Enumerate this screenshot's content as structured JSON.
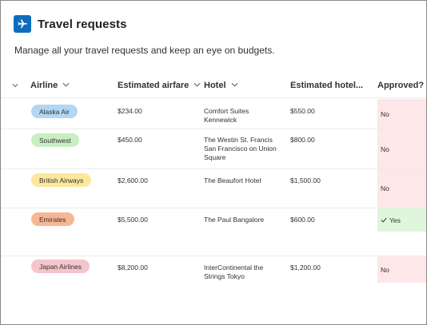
{
  "header": {
    "title": "Travel requests",
    "subtitle": "Manage all your travel requests and keep an eye on budgets."
  },
  "columns": {
    "airline": "Airline",
    "airfare": "Estimated airfare",
    "hotel": "Hotel",
    "hotel_cost": "Estimated hotel...",
    "approved": "Approved?"
  },
  "rows": [
    {
      "airline": "Alaska Air",
      "airline_color": "#b3d6f2",
      "airfare": "$234.00",
      "hotel_line1": "Comfort Suites",
      "hotel_line2": "Kennewick",
      "hotel_line3": "",
      "hotel_cost": "$550.00",
      "approved": "No",
      "approved_status": "no"
    },
    {
      "airline": "Southwest",
      "airline_color": "#c8efc4",
      "airfare": "$450.00",
      "hotel_line1": "The Westin St. Francis",
      "hotel_line2": "San Francisco on Union",
      "hotel_line3": "Square",
      "hotel_cost": "$800.00",
      "approved": "No",
      "approved_status": "no"
    },
    {
      "airline": "British Airways",
      "airline_color": "#fce89d",
      "airfare": "$2,600.00",
      "hotel_line1": "The Beaufort Hotel",
      "hotel_line2": "",
      "hotel_line3": "",
      "hotel_cost": "$1,500.00",
      "approved": "No",
      "approved_status": "no"
    },
    {
      "airline": "Emirates",
      "airline_color": "#f7b795",
      "airfare": "$5,500.00",
      "hotel_line1": "The Paul Bangalore",
      "hotel_line2": "",
      "hotel_line3": "",
      "hotel_cost": "$600.00",
      "approved": "Yes",
      "approved_status": "yes"
    },
    {
      "airline": "Japan Airlines",
      "airline_color": "#f4c5cd",
      "airfare": "$8,200.00",
      "hotel_line1": "InterContinental the",
      "hotel_line2": "Strings Tokyo",
      "hotel_line3": "",
      "hotel_cost": "$1,200.00",
      "approved": "No",
      "approved_status": "no"
    }
  ],
  "icons": {
    "app": "airplane-icon",
    "sort": "chevron-down-icon",
    "check": "check-icon"
  },
  "colors": {
    "accent": "#0f6cbd",
    "no_bg": "#fde7e9",
    "yes_bg": "#dff6dd"
  }
}
